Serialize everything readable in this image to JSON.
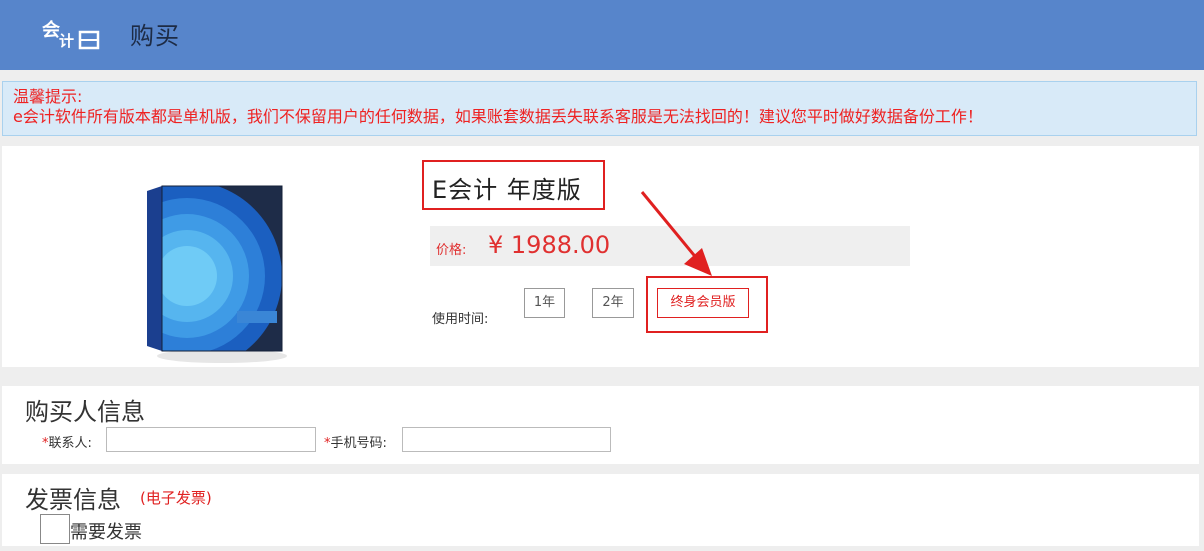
{
  "header": {
    "title": "购买",
    "logo_icon": "e-accounting-logo"
  },
  "notice": {
    "title": "温馨提示:",
    "message": "e会计软件所有版本都是单机版，我们不保留用户的任何数据，如果账套数据丢失联系客服是无法找回的！建议您平时做好数据备份工作！"
  },
  "product": {
    "image_icon": "software-box-image",
    "name": "E会计 年度版",
    "price_label": "价格:",
    "price_value": "¥ 1988.00",
    "usage_label": "使用时间:",
    "durations": [
      "1年",
      "2年",
      "终身会员版"
    ],
    "selected_duration": "终身会员版"
  },
  "buyer": {
    "title": "购买人信息",
    "contact_label": "联系人:",
    "contact_value": "",
    "phone_label": "手机号码:",
    "phone_value": ""
  },
  "invoice": {
    "title": "发票信息",
    "note": "(电子发票)",
    "checkbox_label": "需要发票",
    "checked": false
  },
  "colors": {
    "header_bg": "#5785cb",
    "accent_red": "#e02020",
    "notice_bg": "#d8eaf8"
  }
}
